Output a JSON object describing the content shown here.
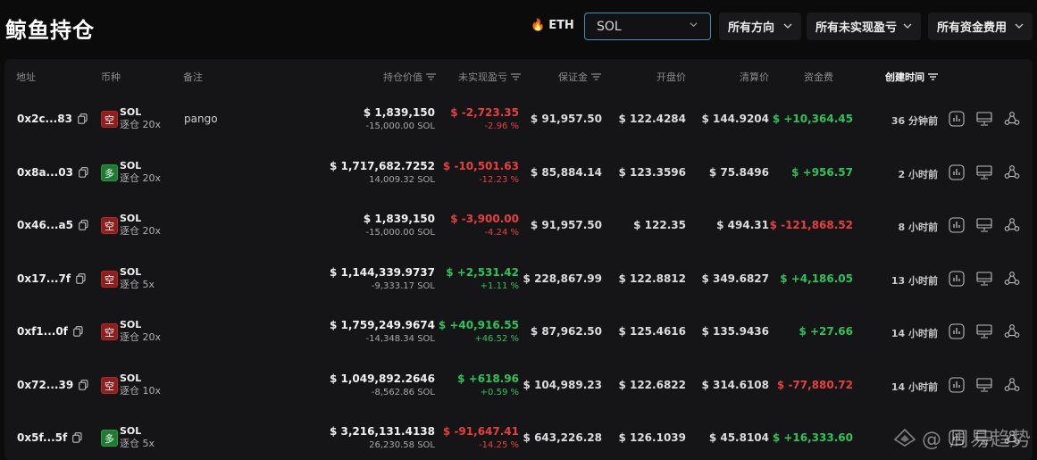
{
  "page": {
    "title": "鲸鱼持仓"
  },
  "filters": {
    "coin_tab": "ETH",
    "search_value": "SOL",
    "direction_label": "所有方向",
    "pnl_label": "所有未实现盈亏",
    "funding_label": "所有资金费用"
  },
  "columns": {
    "address": "地址",
    "coin": "币种",
    "note": "备注",
    "position_value": "持仓价值",
    "unrealized_pnl": "未实现盈亏",
    "margin": "保证金",
    "entry_price": "开盘价",
    "liq_price": "清算价",
    "funding_fee": "资金费",
    "created_time": "创建时间"
  },
  "rows": [
    {
      "address": "0x2c...83",
      "side": "空",
      "side_type": "short",
      "coin": "SOL",
      "mode": "逐仓 20x",
      "note": "pango",
      "value": "$ 1,839,150",
      "qty": "-15,000.00 SOL",
      "pnl": "$ -2,723.35",
      "pnl_pct": "-2.96 %",
      "pnl_type": "neg",
      "margin": "$ 91,957.50",
      "entry": "$ 122.4284",
      "liq": "$ 144.9204",
      "funding": "$ +10,364.45",
      "funding_type": "pos",
      "created": "36 分钟前"
    },
    {
      "address": "0x8a...03",
      "side": "多",
      "side_type": "long",
      "coin": "SOL",
      "mode": "逐仓 20x",
      "note": "",
      "value": "$ 1,717,682.7252",
      "qty": "14,009.32 SOL",
      "pnl": "$ -10,501.63",
      "pnl_pct": "-12.23 %",
      "pnl_type": "neg",
      "margin": "$ 85,884.14",
      "entry": "$ 123.3596",
      "liq": "$ 75.8496",
      "funding": "$ +956.57",
      "funding_type": "pos",
      "created": "2 小时前"
    },
    {
      "address": "0x46...a5",
      "side": "空",
      "side_type": "short",
      "coin": "SOL",
      "mode": "逐仓 20x",
      "note": "",
      "value": "$ 1,839,150",
      "qty": "-15,000.00 SOL",
      "pnl": "$ -3,900.00",
      "pnl_pct": "-4.24 %",
      "pnl_type": "neg",
      "margin": "$ 91,957.50",
      "entry": "$ 122.35",
      "liq": "$ 494.31",
      "funding": "$ -121,868.52",
      "funding_type": "neg",
      "created": "8 小时前"
    },
    {
      "address": "0x17...7f",
      "side": "空",
      "side_type": "short",
      "coin": "SOL",
      "mode": "逐仓 5x",
      "note": "",
      "value": "$ 1,144,339.9737",
      "qty": "-9,333.17 SOL",
      "pnl": "$ +2,531.42",
      "pnl_pct": "+1.11 %",
      "pnl_type": "pos",
      "margin": "$ 228,867.99",
      "entry": "$ 122.8812",
      "liq": "$ 349.6827",
      "funding": "$ +4,186.05",
      "funding_type": "pos",
      "created": "13 小时前"
    },
    {
      "address": "0xf1...0f",
      "side": "空",
      "side_type": "short",
      "coin": "SOL",
      "mode": "逐仓 20x",
      "note": "",
      "value": "$ 1,759,249.9674",
      "qty": "-14,348.34 SOL",
      "pnl": "$ +40,916.55",
      "pnl_pct": "+46.52 %",
      "pnl_type": "pos",
      "margin": "$ 87,962.50",
      "entry": "$ 125.4616",
      "liq": "$ 135.9436",
      "funding": "$ +27.66",
      "funding_type": "pos",
      "created": "14 小时前"
    },
    {
      "address": "0x72...39",
      "side": "空",
      "side_type": "short",
      "coin": "SOL",
      "mode": "逐仓 10x",
      "note": "",
      "value": "$ 1,049,892.2646",
      "qty": "-8,562.86 SOL",
      "pnl": "$ +618.96",
      "pnl_pct": "+0.59 %",
      "pnl_type": "pos",
      "margin": "$ 104,989.23",
      "entry": "$ 122.6822",
      "liq": "$ 314.6108",
      "funding": "$ -77,880.72",
      "funding_type": "neg",
      "created": "14 小时前"
    },
    {
      "address": "0x5f...5f",
      "side": "多",
      "side_type": "long",
      "coin": "SOL",
      "mode": "逐仓 5x",
      "note": "",
      "value": "$ 3,216,131.4138",
      "qty": "26,230.58 SOL",
      "pnl": "$ -91,647.41",
      "pnl_pct": "-14.25 %",
      "pnl_type": "neg",
      "margin": "$ 643,226.28",
      "entry": "$ 126.1039",
      "liq": "$ 45.8104",
      "funding": "$ +16,333.60",
      "funding_type": "pos",
      "created": ""
    }
  ],
  "watermark": {
    "text": "@ 周易趋势"
  },
  "icons": {
    "copy": "copy-icon",
    "chart": "chart-icon",
    "monitor": "monitor-icon",
    "share": "share-icon",
    "sort": "sort-icon",
    "chevron": "chevron-down-icon",
    "fire": "fire-icon"
  },
  "colors": {
    "negative": "#e5403f",
    "positive": "#2fc25b",
    "short_badge": "#8e1f1f",
    "long_badge": "#1f7a32",
    "accent": "#3d8fb5"
  }
}
